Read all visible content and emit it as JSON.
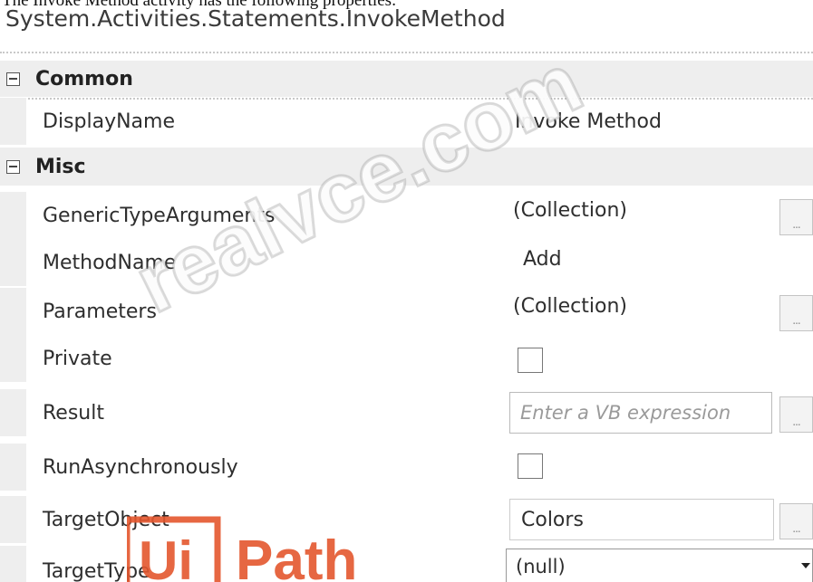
{
  "caption": "The Invoke Method activity has the following properties:",
  "type_title": "System.Activities.Statements.InvokeMethod",
  "sections": {
    "common": {
      "label": "Common"
    },
    "misc": {
      "label": "Misc"
    }
  },
  "properties": {
    "display_name": {
      "name": "DisplayName",
      "value": "Invoke Method"
    },
    "generic_type_arguments": {
      "name": "GenericTypeArguments",
      "value": "(Collection)",
      "button": "..."
    },
    "method_name": {
      "name": "MethodName",
      "value": "Add"
    },
    "parameters": {
      "name": "Parameters",
      "value": "(Collection)",
      "button": "..."
    },
    "private": {
      "name": "Private",
      "checked": false
    },
    "result": {
      "name": "Result",
      "placeholder": "Enter a VB expression",
      "button": "..."
    },
    "run_asynchronously": {
      "name": "RunAsynchronously",
      "checked": false
    },
    "target_object": {
      "name": "TargetObject",
      "value": "Colors",
      "button": "..."
    },
    "target_type": {
      "name": "TargetType",
      "value": "(null)"
    }
  },
  "watermark": "realvce.com",
  "logo": {
    "text": "Ui Path",
    "color": "#e4572e"
  }
}
